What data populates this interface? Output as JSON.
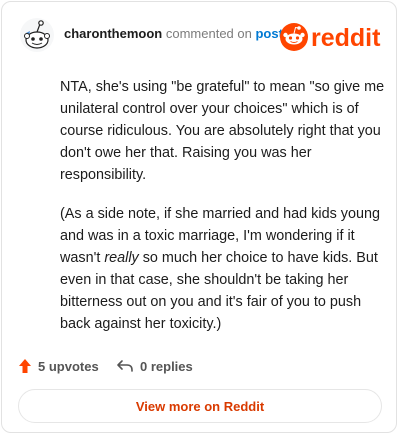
{
  "header": {
    "username": "charonthemoon",
    "action_text": "commented on",
    "link_text": "post",
    "logo_text": "reddit"
  },
  "comment": {
    "paragraph1": "NTA, she's using \"be grateful\" to mean \"so give me unilateral control over your choices\" which is of course ridiculous. You are absolutely right that you don't owe her that. Raising you was her responsibility.",
    "paragraph2_part1": "(As a side note, if she married and had kids young and was in a toxic marriage, I'm wondering if it wasn't ",
    "paragraph2_emphasis": "really",
    "paragraph2_part2": " so much her choice to have kids. But even in that case, she shouldn't be taking her bitterness out on you and it's fair of you to push back against her toxicity.)"
  },
  "actions": {
    "upvotes_label": "5 upvotes",
    "replies_label": "0 replies"
  },
  "footer": {
    "view_more_label": "View more on Reddit"
  },
  "colors": {
    "brand": "#ff4500",
    "link": "#0079d3",
    "cta_text": "#d93a00"
  }
}
